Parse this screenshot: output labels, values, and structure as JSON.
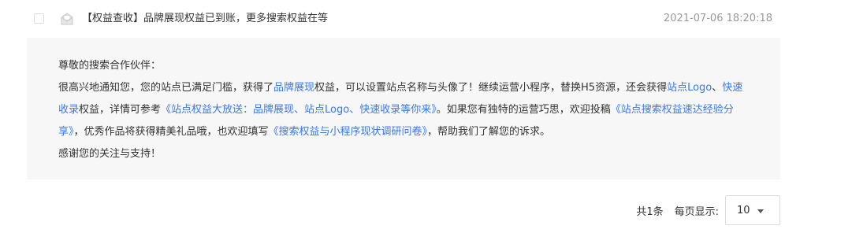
{
  "message": {
    "title": "【权益查收】品牌展现权益已到账，更多搜索权益在等",
    "date": "2021-07-06 18:20:18"
  },
  "detail": {
    "greeting": "尊敬的搜索合作伙伴：",
    "p1_a": "很高兴地通知您，您的站点已满足门槛，获得了",
    "link_brand": "品牌展现",
    "p1_b": "权益，可以设置站点名称与头像了！继续运营小程序，替换H5资源，还会获得",
    "link_logo": "站点Logo",
    "p1_c": "、",
    "link_fast": "快速收录",
    "p1_d": "权益，详情可参考",
    "link_article": "《站点权益大放送：品牌展现、站点Logo、快速收录等你来》",
    "p1_e": "。如果您有独特的运营巧思，欢迎投稿",
    "link_submit": "《站点搜索权益速达经验分享》",
    "p1_f": "，优秀作品将获得精美礼品哦，也欢迎填写",
    "link_survey": "《搜索权益与小程序现状调研问卷》",
    "p1_g": "，帮助我们了解您的诉求。",
    "closing": "感谢您的关注与支持！"
  },
  "pager": {
    "total": "共1条",
    "per_page_label": "每页显示:",
    "per_page_value": "10"
  }
}
